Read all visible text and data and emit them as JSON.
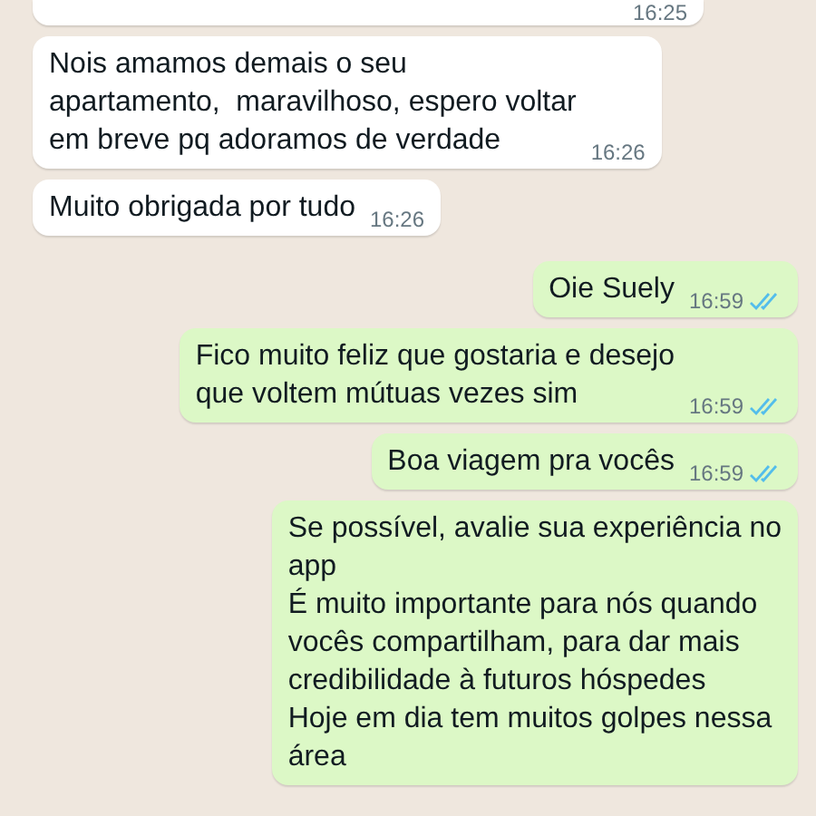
{
  "messages": [
    {
      "kind": "incoming",
      "time": "16:25"
    },
    {
      "kind": "incoming",
      "text": "Nois amamos demais o seu\napartamento,  maravilhoso, espero voltar\nem breve pq adoramos de verdade",
      "time": "16:26"
    },
    {
      "kind": "incoming",
      "text": "Muito obrigada por tudo",
      "time": "16:26"
    },
    {
      "kind": "outgoing",
      "text": "Oie Suely",
      "time": "16:59",
      "read": true
    },
    {
      "kind": "outgoing",
      "text": "Fico muito feliz que gostaria e desejo\nque voltem mútuas vezes sim",
      "time": "16:59",
      "read": true
    },
    {
      "kind": "outgoing",
      "text": "Boa viagem pra vocês",
      "time": "16:59",
      "read": true
    },
    {
      "kind": "outgoing",
      "text": "Se possível, avalie sua experiência no\napp\nÉ muito importante para nós quando\nvocês compartilham, para dar mais\ncredibilidade à futuros hóspedes\nHoje em dia tem muitos golpes nessa\nárea"
    }
  ]
}
